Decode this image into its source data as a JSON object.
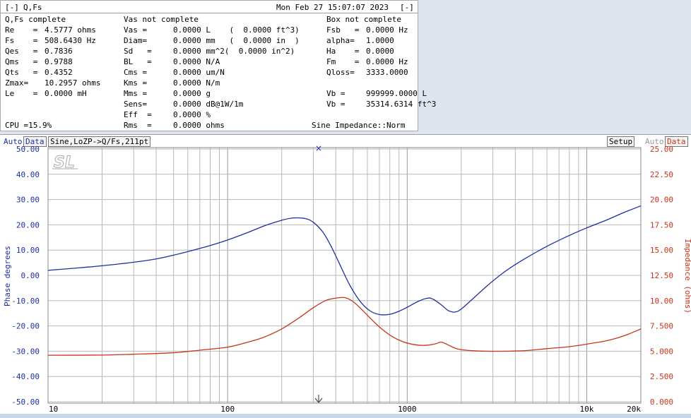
{
  "window": {
    "menu": "[-]",
    "title": "Q,Fs",
    "datetime": "Mon Feb 27 15:07:07 2023",
    "close": "[-]"
  },
  "sections": {
    "qfs": "Q,Fs complete",
    "vas": "Vas not complete",
    "box": "Box not complete"
  },
  "col1": [
    {
      "label": "Re    =",
      "value": "4.5777 ohms"
    },
    {
      "label": "Fs    =",
      "value": "508.6430 Hz"
    },
    {
      "label": "Qes   =",
      "value": "0.7836"
    },
    {
      "label": "Qms   =",
      "value": "0.9788"
    },
    {
      "label": "Qts   =",
      "value": "0.4352"
    },
    {
      "label": "Zmax=",
      "value": "10.2957 ohms"
    },
    {
      "label": "Le    =",
      "value": "0.0000 mH"
    }
  ],
  "col2": [
    {
      "label": "Vas =",
      "value": "0.0000 L    (  0.0000 ft^3)"
    },
    {
      "label": "Diam=",
      "value": "0.0000 mm   (  0.0000 in  )"
    },
    {
      "label": "Sd   =",
      "value": "0.0000 mm^2(  0.0000 in^2)"
    },
    {
      "label": "BL   =",
      "value": "0.0000 N/A"
    },
    {
      "label": "Cms =",
      "value": "0.0000 um/N"
    },
    {
      "label": "Kms =",
      "value": "0.0000 N/m"
    },
    {
      "label": "Mms =",
      "value": "0.0000 g"
    },
    {
      "label": "Sens=",
      "value": "0.0000 dB@1W/1m"
    },
    {
      "label": "Eff  =",
      "value": "0.0000 %"
    },
    {
      "label": "Rms  =",
      "value": "0.0000 ohms"
    }
  ],
  "col3": [
    {
      "label": "Fsb   =",
      "value": "0.0000 Hz"
    },
    {
      "label": "alpha=",
      "value": "1.0000"
    },
    {
      "label": "Ha    =",
      "value": "0.0000"
    },
    {
      "label": "Fm    =",
      "value": "0.0000 Hz"
    },
    {
      "label": "Qloss=",
      "value": "3333.0000"
    },
    {
      "label": "",
      "value": ""
    },
    {
      "label": "Vb =",
      "value": "999999.0000 L"
    },
    {
      "label": "Vb =",
      "value": "35314.6314 ft^3"
    }
  ],
  "status": {
    "cpu": "CPU =15.9%",
    "mode": "Sine Impedance::Norm"
  },
  "graph": {
    "auto_left": "Auto",
    "data_left": "Data",
    "title": "Sine,LoZP->Q/Fs,211pt",
    "setup": "Setup",
    "auto_right": "Auto",
    "data_right": "Data",
    "left_axis_label": "Phase degrees",
    "right_axis_label": "Impedance (ohms)",
    "logo": "SL",
    "colors": {
      "phase": "#1e2fa0",
      "impedance": "#c8341c",
      "grid": "#b8b8b8",
      "left_ticks": "#1e2fa0",
      "right_ticks": "#c8341c"
    }
  },
  "chart_data": {
    "type": "line",
    "x_scale": "log",
    "xlim": [
      10,
      20000
    ],
    "x_tick_labels": [
      {
        "value": 10,
        "label": "10"
      },
      {
        "value": 100,
        "label": "100"
      },
      {
        "value": 1000,
        "label": "1000"
      },
      {
        "value": 10000,
        "label": "10k"
      },
      {
        "value": 20000,
        "label": "20k"
      }
    ],
    "y_left": {
      "lim": [
        -50,
        50
      ],
      "ticks": [
        "50.00",
        "40.00",
        "30.00",
        "20.00",
        "10.00",
        "0.00",
        "-10.00",
        "-20.00",
        "-30.00",
        "-40.00",
        "-50.00"
      ]
    },
    "y_right": {
      "lim": [
        0,
        25
      ],
      "ticks": [
        "25.00",
        "22.50",
        "20.00",
        "17.50",
        "15.00",
        "12.50",
        "10.00",
        "7.500",
        "5.000",
        "2.500",
        "0.000"
      ]
    },
    "grid": true,
    "series": [
      {
        "axis": "left",
        "x": [
          10,
          15,
          20,
          30,
          40,
          50,
          60,
          80,
          100,
          130,
          160,
          200,
          230,
          270,
          300,
          340,
          380,
          430,
          480,
          550,
          620,
          700,
          800,
          900,
          1000,
          1150,
          1300,
          1400,
          1550,
          1700,
          1850,
          2000,
          2300,
          2800,
          3500,
          4500,
          6000,
          8000,
          10000,
          13000,
          16000,
          20000
        ],
        "y": [
          2.0,
          3.0,
          3.8,
          5.2,
          6.5,
          8.0,
          9.4,
          11.8,
          14.0,
          17.0,
          19.6,
          21.8,
          22.7,
          22.5,
          21.0,
          17.0,
          11.0,
          3.0,
          -4.0,
          -10.5,
          -14.0,
          -15.5,
          -15.4,
          -14.2,
          -12.6,
          -10.3,
          -9.0,
          -9.5,
          -11.7,
          -14.0,
          -14.5,
          -13.3,
          -9.5,
          -4.0,
          1.5,
          6.5,
          11.5,
          15.8,
          18.8,
          22.0,
          24.8,
          27.5
        ]
      },
      {
        "axis": "right",
        "x": [
          10,
          20,
          30,
          50,
          70,
          100,
          130,
          160,
          200,
          250,
          300,
          350,
          400,
          450,
          500,
          560,
          620,
          700,
          800,
          900,
          1000,
          1150,
          1300,
          1450,
          1550,
          1700,
          1850,
          2000,
          2300,
          2800,
          3500,
          4500,
          6000,
          8000,
          10000,
          13000,
          16000,
          20000
        ],
        "y": [
          4.6,
          4.62,
          4.7,
          4.85,
          5.1,
          5.4,
          5.9,
          6.4,
          7.2,
          8.3,
          9.3,
          10.0,
          10.25,
          10.3,
          9.9,
          9.1,
          8.3,
          7.4,
          6.6,
          6.1,
          5.8,
          5.6,
          5.6,
          5.75,
          5.9,
          5.6,
          5.3,
          5.15,
          5.05,
          5.0,
          5.0,
          5.05,
          5.25,
          5.45,
          5.7,
          6.05,
          6.5,
          7.2
        ]
      }
    ]
  }
}
